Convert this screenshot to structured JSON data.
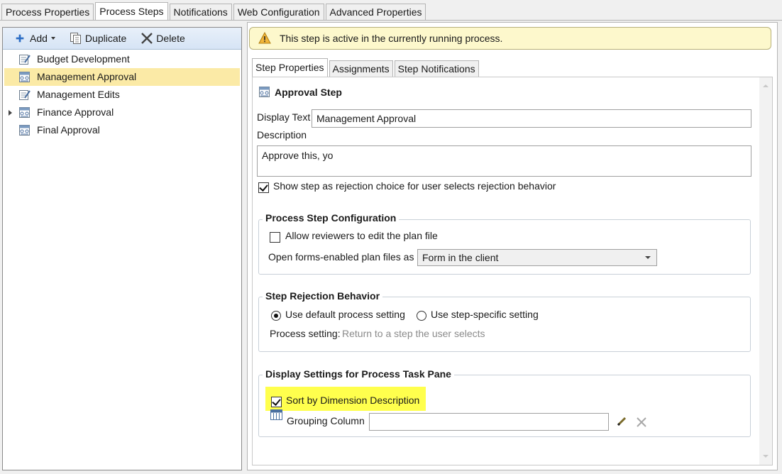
{
  "top_tabs": [
    "Process Properties",
    "Process Steps",
    "Notifications",
    "Web Configuration",
    "Advanced Properties"
  ],
  "active_top_tab": "Process Steps",
  "toolbar": {
    "add_label": "Add",
    "duplicate_label": "Duplicate",
    "delete_label": "Delete"
  },
  "tree": {
    "items": [
      {
        "label": "Budget Development",
        "icon": "edit-step-icon",
        "selected": false,
        "expandable": false
      },
      {
        "label": "Management Approval",
        "icon": "approval-step-icon",
        "selected": true,
        "expandable": false
      },
      {
        "label": "Management Edits",
        "icon": "edit-step-icon",
        "selected": false,
        "expandable": false
      },
      {
        "label": "Finance Approval",
        "icon": "approval-step-icon",
        "selected": false,
        "expandable": true
      },
      {
        "label": "Final Approval",
        "icon": "approval-step-icon",
        "selected": false,
        "expandable": false
      }
    ]
  },
  "warning": {
    "text": "This step is active in the currently running process."
  },
  "inner_tabs": [
    "Step Properties",
    "Assignments",
    "Step Notifications"
  ],
  "active_inner_tab": "Step Properties",
  "step": {
    "type_label": "Approval Step",
    "display_text_label": "Display Text",
    "display_text_value": "Management Approval",
    "description_label": "Description",
    "description_value": "Approve this, yo",
    "rejection_choice_label": "Show step as rejection choice for user selects rejection behavior",
    "rejection_choice_checked": true
  },
  "config_group": {
    "title": "Process Step Configuration",
    "allow_edit_label": "Allow reviewers to edit the plan file",
    "allow_edit_checked": false,
    "open_forms_label": "Open forms-enabled plan files as",
    "open_forms_value": "Form in the client"
  },
  "rejection_group": {
    "title": "Step Rejection Behavior",
    "option_default": "Use default process setting",
    "option_specific": "Use step-specific setting",
    "selected_option": "default",
    "process_setting_label": "Process setting:",
    "process_setting_value": "Return to a step the user selects"
  },
  "display_group": {
    "title": "Display Settings for Process Task Pane",
    "sort_label": "Sort by Dimension Description",
    "sort_checked": true,
    "grouping_label": "Grouping Column",
    "grouping_value": ""
  },
  "colors": {
    "selection": "#fbeaa6",
    "highlight": "#ffff4d",
    "warning_bg": "#fdf8cc",
    "toolbar_bg": "#dce8f6"
  }
}
